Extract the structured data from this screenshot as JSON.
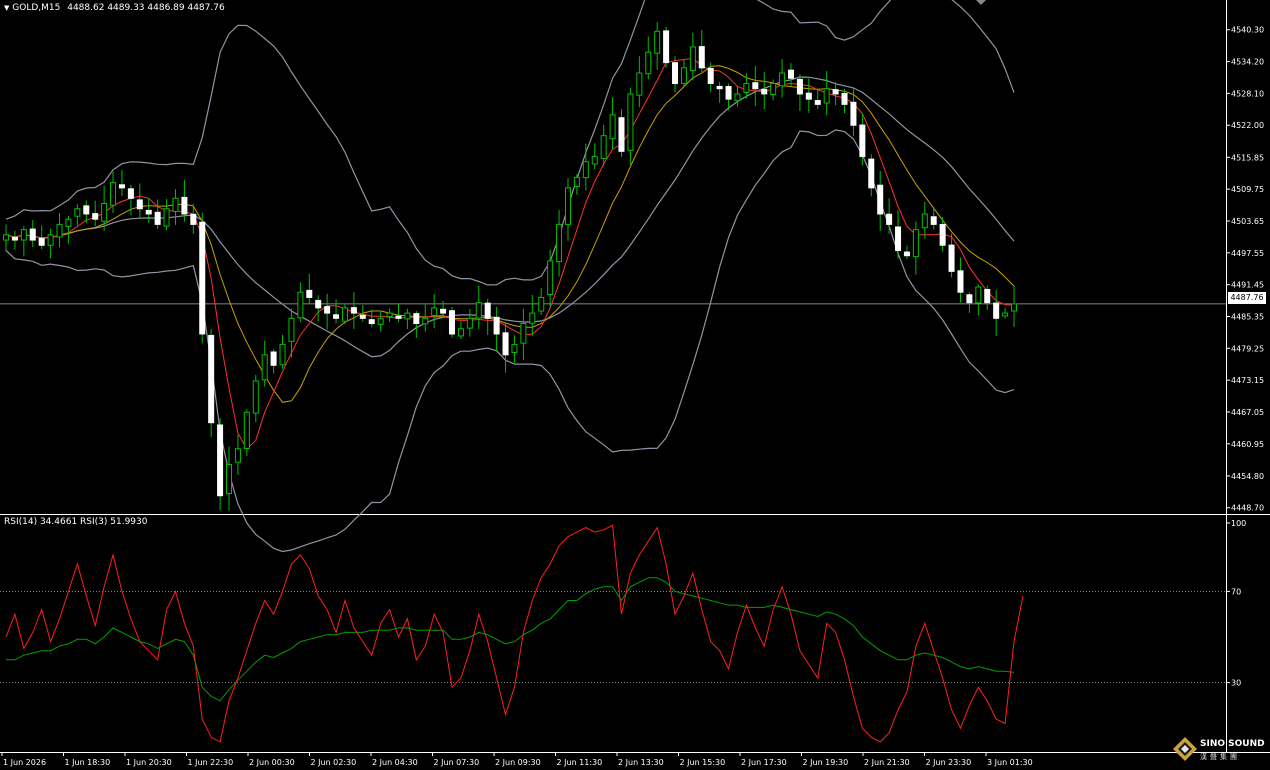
{
  "header": {
    "symbol_label": "GOLD,M15",
    "ohlc": "4488.62 4489.33 4486.89 4487.76",
    "rsi_label": "RSI(14) 34.4661  RSI(3) 51.9930"
  },
  "current_price": "4487.76",
  "logo": {
    "name": "SINO SOUND",
    "sub": "漢聲集團"
  },
  "colors": {
    "background": "#000000",
    "grid_axis": "#ffffff",
    "bull_candle": "#00c000",
    "bear_candle": "#ffffff",
    "bollinger": "#8f95a3",
    "ma_fast": "#ff3030",
    "ma_slow": "#c8a000",
    "rsi14": "#00a000",
    "rsi3": "#ff2020",
    "level_line": "#aaaaaa"
  },
  "chart_data": [
    {
      "type": "candlestick",
      "title": "GOLD,M15",
      "ylim": [
        4447.5,
        4546.0
      ],
      "y_ticks": [
        "4540.30",
        "4534.20",
        "4528.10",
        "4522.00",
        "4515.85",
        "4509.75",
        "4503.65",
        "4497.55",
        "4491.45",
        "4485.35",
        "4479.25",
        "4473.15",
        "4467.05",
        "4460.95",
        "4454.80",
        "4448.70"
      ],
      "x_ticks": [
        "1 Jun 2026",
        "1 Jun 18:30",
        "1 Jun 20:30",
        "1 Jun 22:30",
        "2 Jun 00:30",
        "2 Jun 02:30",
        "2 Jun 04:30",
        "2 Jun 07:30",
        "2 Jun 09:30",
        "2 Jun 11:30",
        "2 Jun 13:30",
        "2 Jun 15:30",
        "2 Jun 17:30",
        "2 Jun 19:30",
        "2 Jun 21:30",
        "2 Jun 23:30",
        "3 Jun 01:30"
      ],
      "overlays": [
        "Bollinger Bands",
        "MA fast",
        "MA slow"
      ],
      "closes": [
        4501.0,
        4500.0,
        4502.0,
        4500.0,
        4499.0,
        4501.0,
        4503.0,
        4504.0,
        4506.0,
        4505.0,
        4504.0,
        4507.0,
        4511.0,
        4510.0,
        4508.0,
        4506.0,
        4505.0,
        4503.0,
        4506.0,
        4508.0,
        4505.0,
        4503.0,
        4482.0,
        4465.0,
        4451.0,
        4457.0,
        4460.0,
        4467.0,
        4473.0,
        4478.0,
        4476.0,
        4480.0,
        4485.0,
        4490.0,
        4489.0,
        4487.0,
        4486.0,
        4485.0,
        4487.0,
        4486.0,
        4485.0,
        4484.0,
        4485.0,
        4486.0,
        4485.0,
        4486.0,
        4484.0,
        4485.0,
        4487.0,
        4486.0,
        4482.0,
        4483.0,
        4485.0,
        4488.0,
        4485.0,
        4482.0,
        4478.0,
        4480.0,
        4484.0,
        4486.0,
        4489.0,
        4496.0,
        4503.0,
        4510.0,
        4512.0,
        4515.0,
        4516.0,
        4520.0,
        4524.0,
        4517.0,
        4528.0,
        4532.0,
        4536.0,
        4540.0,
        4534.0,
        4530.0,
        4533.0,
        4537.0,
        4533.0,
        4530.0,
        4529.0,
        4527.0,
        4528.0,
        4530.0,
        4529.0,
        4528.0,
        4530.0,
        4532.0,
        4531.0,
        4528.0,
        4527.0,
        4526.0,
        4529.0,
        4528.0,
        4526.0,
        4522.0,
        4516.0,
        4510.0,
        4505.0,
        4503.0,
        4498.0,
        4497.0,
        4502.0,
        4505.0,
        4503.0,
        4499.0,
        4494.0,
        4490.0,
        4488.0,
        4491.0,
        4488.0,
        4485.0,
        4486.0,
        4487.76
      ]
    },
    {
      "type": "line",
      "title": "RSI(14) 34.4661  RSI(3) 51.9930",
      "ylim": [
        0,
        100
      ],
      "levels": [
        30,
        70
      ],
      "y_ticks": [
        "100",
        "70",
        "30"
      ],
      "series": [
        {
          "name": "RSI(14)",
          "values": [
            40,
            40,
            42,
            43,
            44,
            44,
            46,
            47,
            49,
            49,
            47,
            50,
            54,
            52,
            50,
            48,
            47,
            45,
            47,
            49,
            48,
            42,
            28,
            24,
            22,
            27,
            31,
            35,
            39,
            42,
            41,
            43,
            45,
            48,
            49,
            50,
            51,
            51,
            52,
            52,
            52,
            53,
            53,
            53,
            54,
            54,
            53,
            53,
            53,
            53,
            49,
            49,
            50,
            52,
            51,
            49,
            47,
            48,
            51,
            53,
            56,
            58,
            62,
            66,
            66,
            69,
            71,
            72,
            72,
            66,
            72,
            74,
            76,
            76,
            74,
            70,
            69,
            68,
            67,
            66,
            65,
            64,
            64,
            63,
            63,
            63,
            64,
            63,
            62,
            61,
            60,
            59,
            61,
            60,
            58,
            55,
            50,
            47,
            44,
            42,
            40,
            40,
            42,
            43,
            42,
            41,
            39,
            37,
            36,
            37,
            36,
            35,
            35,
            34.47
          ]
        },
        {
          "name": "RSI(3)",
          "values": [
            50,
            60,
            45,
            52,
            62,
            48,
            58,
            70,
            82,
            68,
            55,
            72,
            86,
            70,
            58,
            48,
            44,
            40,
            62,
            70,
            56,
            46,
            14,
            6,
            4,
            22,
            32,
            44,
            56,
            66,
            60,
            70,
            82,
            86,
            80,
            68,
            62,
            52,
            66,
            54,
            48,
            42,
            56,
            62,
            50,
            58,
            40,
            46,
            60,
            52,
            28,
            32,
            44,
            60,
            48,
            32,
            16,
            28,
            52,
            66,
            76,
            82,
            90,
            94,
            96,
            98,
            96,
            97,
            99,
            60,
            78,
            86,
            92,
            98,
            82,
            60,
            68,
            78,
            62,
            48,
            44,
            36,
            52,
            64,
            54,
            46,
            62,
            72,
            60,
            44,
            38,
            32,
            56,
            52,
            40,
            24,
            10,
            6,
            4,
            8,
            18,
            26,
            46,
            56,
            44,
            32,
            18,
            10,
            20,
            28,
            22,
            14,
            12,
            48,
            68
          ]
        }
      ]
    }
  ]
}
